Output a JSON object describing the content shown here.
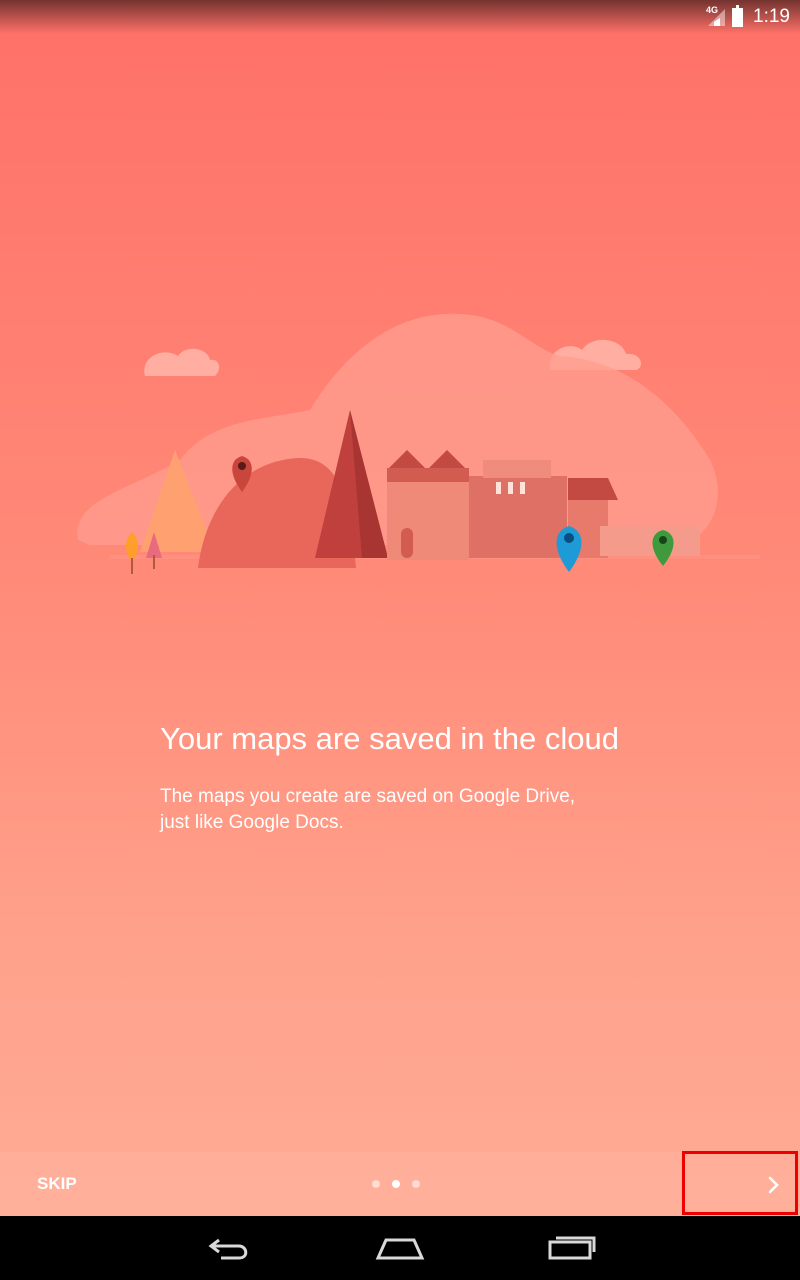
{
  "status_bar": {
    "network": "4G",
    "time": "1:19"
  },
  "onboarding": {
    "title": "Your maps are saved in the cloud",
    "description_line1": "The maps you create are saved on Google Drive,",
    "description_line2": "just like Google Docs.",
    "current_page": 2,
    "total_pages": 3
  },
  "bottom_bar": {
    "skip_label": "SKIP",
    "next_icon": "chevron-right-icon"
  },
  "nav_bar": {
    "back_icon": "back-icon",
    "home_icon": "home-icon",
    "recents_icon": "recents-icon"
  },
  "colors": {
    "background_top": "#ff7068",
    "background_bottom": "#ffad97",
    "pin_blue": "#1e9ad6",
    "pin_green": "#3e9a3c",
    "pin_red": "#c9463d",
    "highlight": "#ee0000"
  }
}
